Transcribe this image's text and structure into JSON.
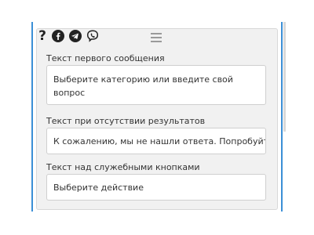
{
  "toolbar": {
    "icons": [
      "help-icon",
      "facebook-icon",
      "telegram-icon",
      "viber-icon"
    ],
    "help_glyph": "?"
  },
  "fields": [
    {
      "label": "Текст первого сообщения",
      "value": "Выберите категорию или введите свой вопрос"
    },
    {
      "label": "Текст при отсутствии результатов",
      "value": "К сожалению, мы не нашли ответа. Попробуйте"
    },
    {
      "label": "Текст над служебными кнопками",
      "value": "Выберите действие"
    }
  ],
  "colors": {
    "accent": "#3b8fd6",
    "panel_bg": "#f1f1f1"
  }
}
